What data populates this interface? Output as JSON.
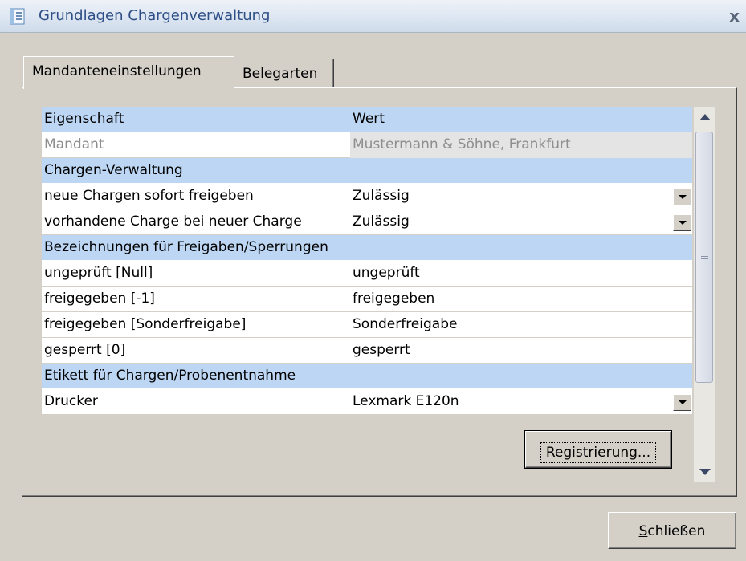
{
  "window": {
    "title": "Grundlagen Chargenverwaltung",
    "close_glyph": "x"
  },
  "tabs": [
    {
      "label": "Mandanteneinstellungen",
      "active": true
    },
    {
      "label": "Belegarten",
      "active": false
    }
  ],
  "grid": {
    "columns": [
      "Eigenschaft",
      "Wert"
    ],
    "mandant": {
      "property": "Mandant",
      "value": "Mustermann & Söhne, Frankfurt"
    },
    "groups": {
      "chargen": "Chargen-Verwaltung",
      "bezeichnungen": "Bezeichnungen für Freigaben/Sperrungen",
      "etikett": "Etikett für Chargen/Probenentnahme"
    },
    "rows": [
      {
        "property": "neue Chargen sofort freigeben",
        "value": "Zulässig"
      },
      {
        "property": "vorhandene Charge bei neuer Charge",
        "value": "Zulässig"
      },
      {
        "property": "ungeprüft [Null]",
        "value": "ungeprüft"
      },
      {
        "property": "freigegeben [-1]",
        "value": "freigegeben"
      },
      {
        "property": "freigegeben [Sonderfreigabe]",
        "value": "Sonderfreigabe"
      },
      {
        "property": "gesperrt [0]",
        "value": "gesperrt"
      },
      {
        "property": "Drucker",
        "value": "Lexmark E120n"
      }
    ]
  },
  "buttons": {
    "registrierung": "Registrierung...",
    "schliessen_first": "S",
    "schliessen_rest": "chließen"
  },
  "colors": {
    "title_text": "#2e4f86",
    "header_row": "#bcd6f3",
    "dialog_bg": "#d4d0c8"
  }
}
